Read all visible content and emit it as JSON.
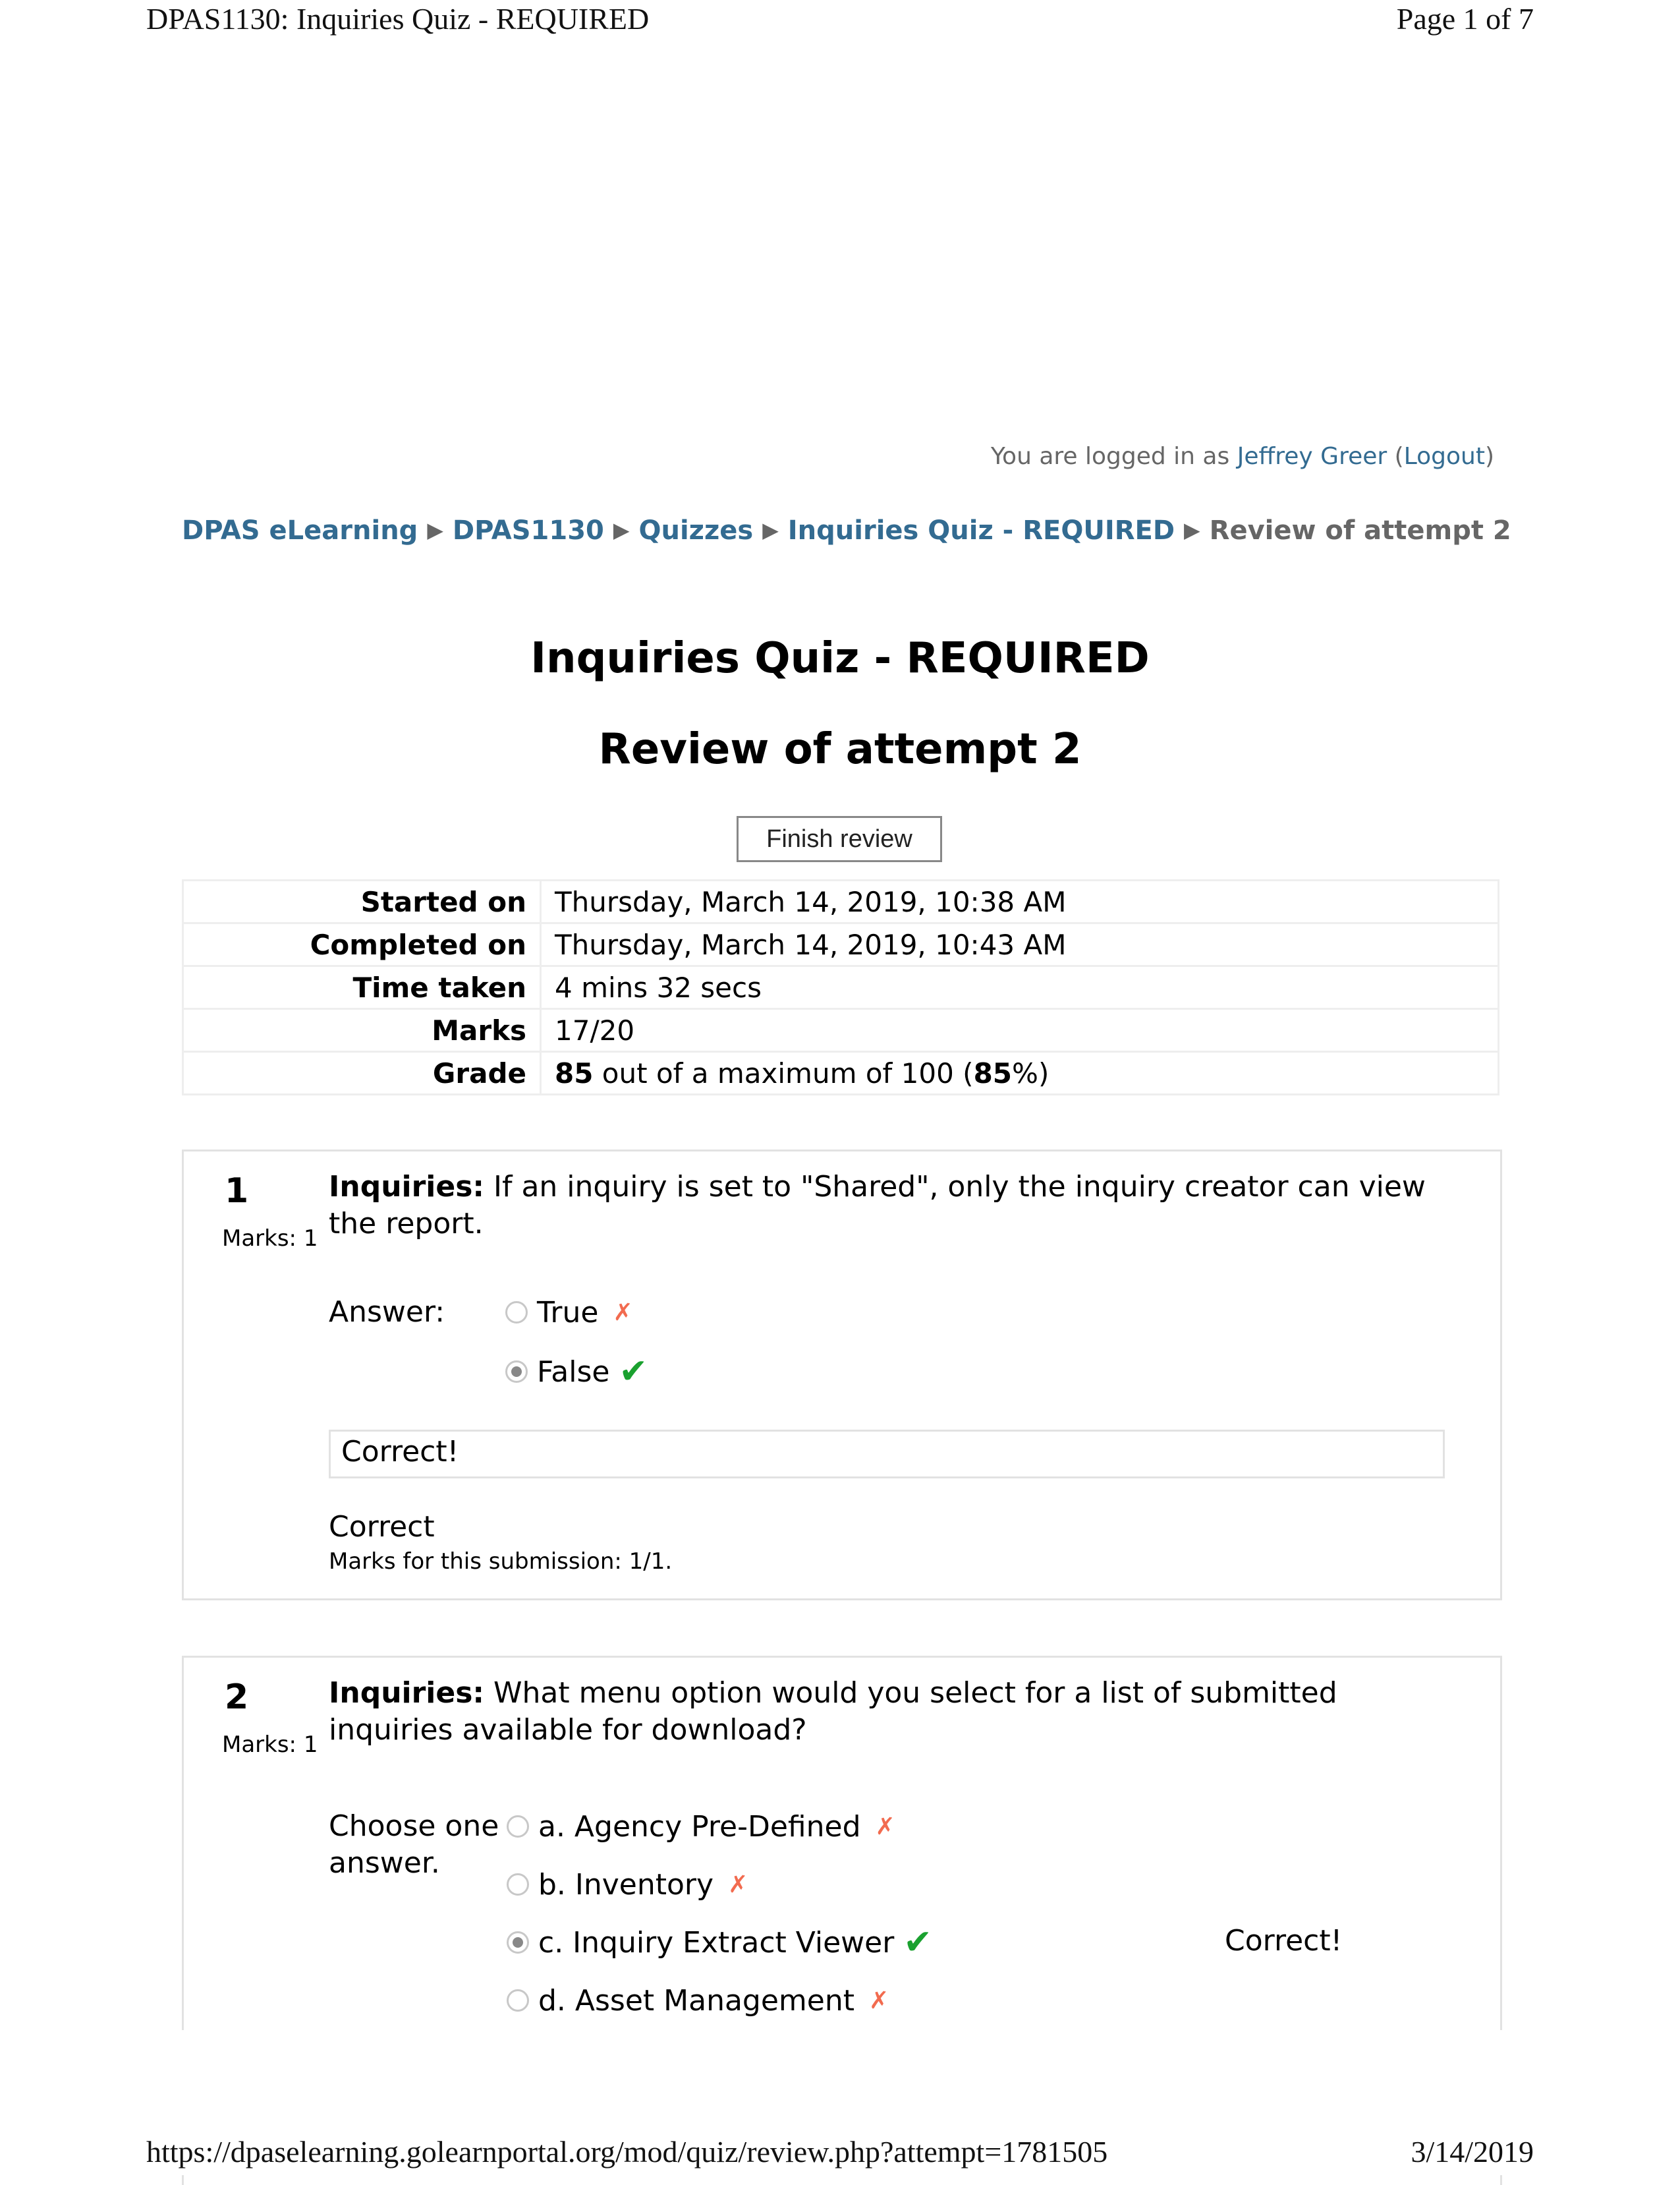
{
  "print_header": {
    "title": "DPAS1130: Inquiries Quiz - REQUIRED",
    "page": "Page 1 of 7"
  },
  "print_footer": {
    "url": "https://dpaselearning.golearnportal.org/mod/quiz/review.php?attempt=1781505",
    "date": "3/14/2019"
  },
  "login": {
    "prefix": "You are logged in as ",
    "user": "Jeffrey Greer",
    "open": " (",
    "logout": "Logout",
    "close": ")"
  },
  "breadcrumb": {
    "items": [
      "DPAS eLearning",
      "DPAS1130",
      "Quizzes",
      "Inquiries Quiz - REQUIRED"
    ],
    "current": "Review of attempt 2",
    "separator": "▶"
  },
  "title": "Inquiries Quiz - REQUIRED",
  "subtitle": "Review of attempt 2",
  "finish_button": "Finish review",
  "summary": [
    {
      "label": "Started on",
      "value": "Thursday, March 14, 2019, 10:38 AM"
    },
    {
      "label": "Completed on",
      "value": "Thursday, March 14, 2019, 10:43 AM"
    },
    {
      "label": "Time taken",
      "value": "4 mins 32 secs"
    },
    {
      "label": "Marks",
      "value": "17/20"
    },
    {
      "label": "Grade",
      "grade_value": "85",
      "mid": " out of a maximum of 100 (",
      "percent": "85",
      "end": "%)"
    }
  ],
  "questions": [
    {
      "number": "1",
      "marks": "Marks: 1",
      "category": "Inquiries:",
      "text": " If an inquiry is set to \"Shared\", only the inquiry creator can view the report.",
      "answer_label": "Answer:",
      "options": [
        {
          "label": "True",
          "selected": false,
          "result": "incorrect",
          "icon": "cross-icon"
        },
        {
          "label": "False",
          "selected": true,
          "result": "correct",
          "icon": "check-icon"
        }
      ],
      "feedback": "Correct!",
      "grade": "Correct",
      "marks_submission": "Marks for this submission: 1/1."
    },
    {
      "number": "2",
      "marks": "Marks: 1",
      "category": "Inquiries:",
      "text": " What menu option would you select for a list of submitted inquiries available for download?",
      "answer_label": "Choose one answer.",
      "options": [
        {
          "label": "a. Agency Pre-Defined",
          "selected": false,
          "result": "incorrect",
          "icon": "cross-icon"
        },
        {
          "label": "b. Inventory",
          "selected": false,
          "result": "incorrect",
          "icon": "cross-icon"
        },
        {
          "label": "c. Inquiry Extract Viewer",
          "selected": true,
          "result": "correct",
          "icon": "check-icon"
        },
        {
          "label": "d. Asset Management",
          "selected": false,
          "result": "incorrect",
          "icon": "cross-icon"
        }
      ],
      "feedback": "Correct!"
    }
  ],
  "icons": {
    "cross": "✗",
    "check": "✔"
  },
  "colors": {
    "link": "#336b91",
    "incorrect": "#f26b4f",
    "correct": "#1aa12f",
    "muted": "#666666"
  }
}
